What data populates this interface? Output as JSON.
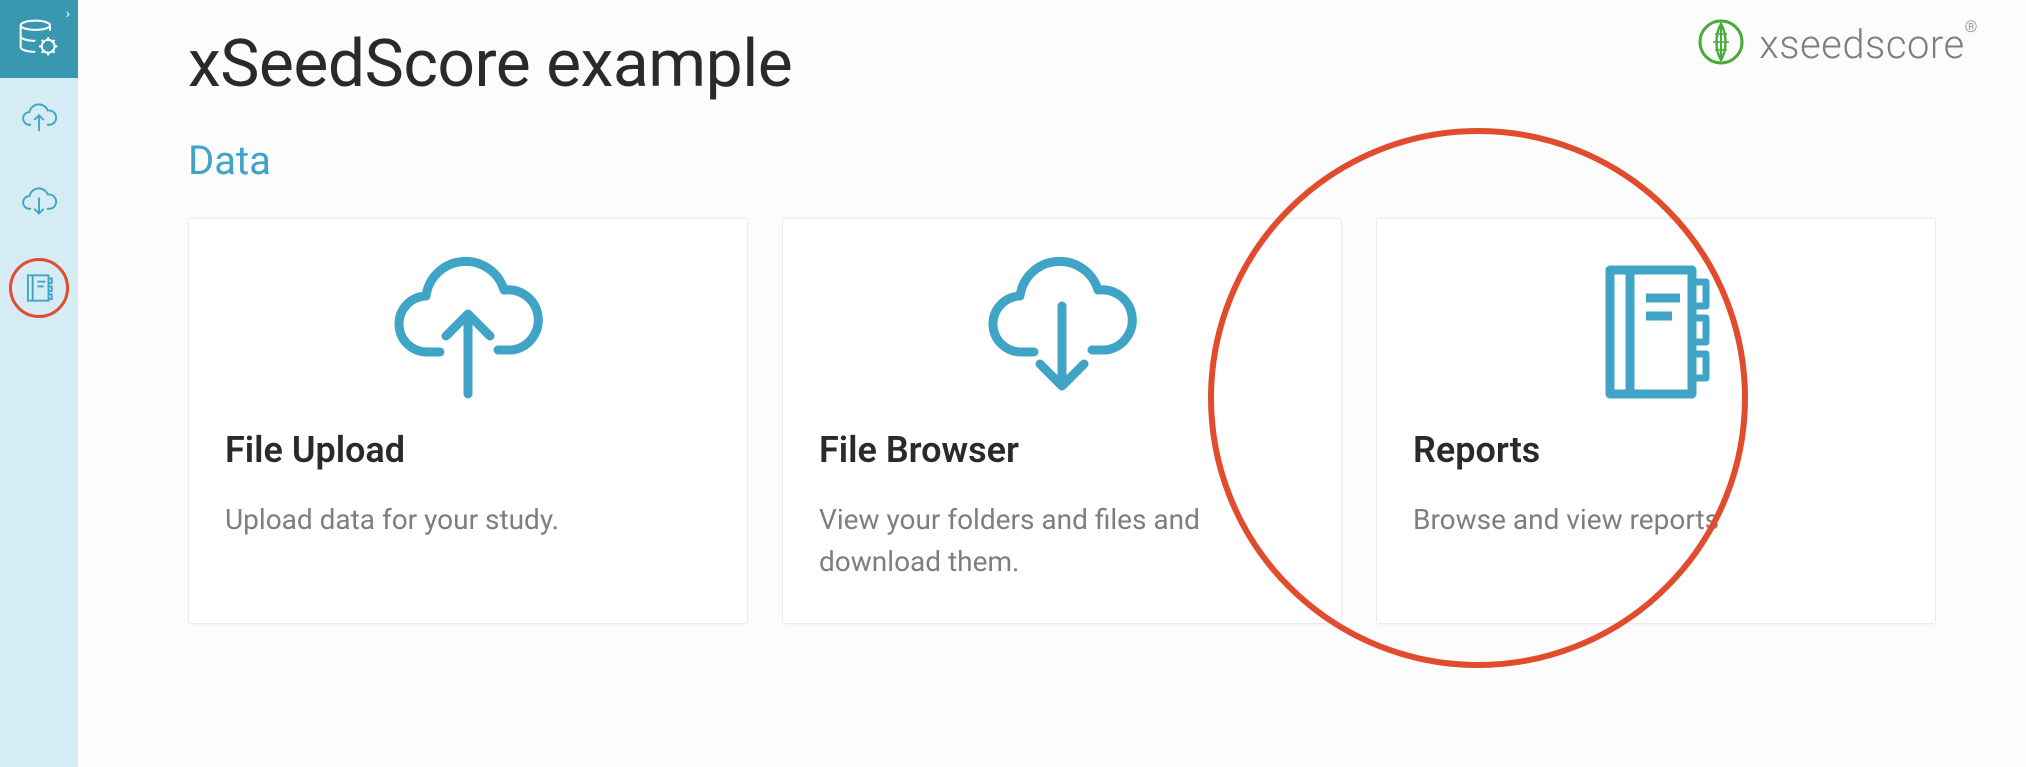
{
  "header": {
    "title": "xSeedScore example",
    "subtitle": "Data",
    "brand_text": "xseedscore",
    "brand_reg": "®"
  },
  "sidebar": {
    "items": [
      {
        "name": "database-settings-icon"
      },
      {
        "name": "cloud-upload-icon"
      },
      {
        "name": "cloud-download-icon"
      },
      {
        "name": "notebook-icon"
      }
    ]
  },
  "cards": [
    {
      "icon": "cloud-upload-icon",
      "title": "File Upload",
      "desc": "Upload data for your study."
    },
    {
      "icon": "cloud-download-icon",
      "title": "File Browser",
      "desc": "View your folders and files and download them."
    },
    {
      "icon": "notebook-icon",
      "title": "Reports",
      "desc": "Browse and view reports"
    }
  ]
}
